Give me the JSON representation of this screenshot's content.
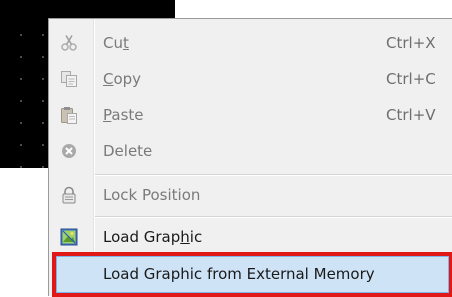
{
  "menu": {
    "items": [
      {
        "label_pre": "Cu",
        "label_ul": "t",
        "label_post": "",
        "shortcut": "Ctrl+X",
        "icon": "scissors-icon",
        "enabled": false
      },
      {
        "label_pre": "",
        "label_ul": "C",
        "label_post": "opy",
        "shortcut": "Ctrl+C",
        "icon": "copy-icon",
        "enabled": false
      },
      {
        "label_pre": "",
        "label_ul": "P",
        "label_post": "aste",
        "shortcut": "Ctrl+V",
        "icon": "paste-icon",
        "enabled": false
      },
      {
        "label_pre": "Delete",
        "label_ul": "",
        "label_post": "",
        "shortcut": "",
        "icon": "delete-icon",
        "enabled": false
      },
      {
        "label_pre": "Lock Position",
        "label_ul": "",
        "label_post": "",
        "shortcut": "",
        "icon": "lock-icon",
        "enabled": false
      },
      {
        "label_pre": "Load Grap",
        "label_ul": "h",
        "label_post": "ic",
        "shortcut": "",
        "icon": "image-icon",
        "enabled": true
      },
      {
        "label_pre": "Load Graphic from External Memory",
        "label_ul": "",
        "label_post": "",
        "shortcut": "",
        "icon": "",
        "enabled": true
      }
    ]
  },
  "colors": {
    "highlight_border": "#e01818",
    "hover_fill": "#cfe3f7"
  }
}
